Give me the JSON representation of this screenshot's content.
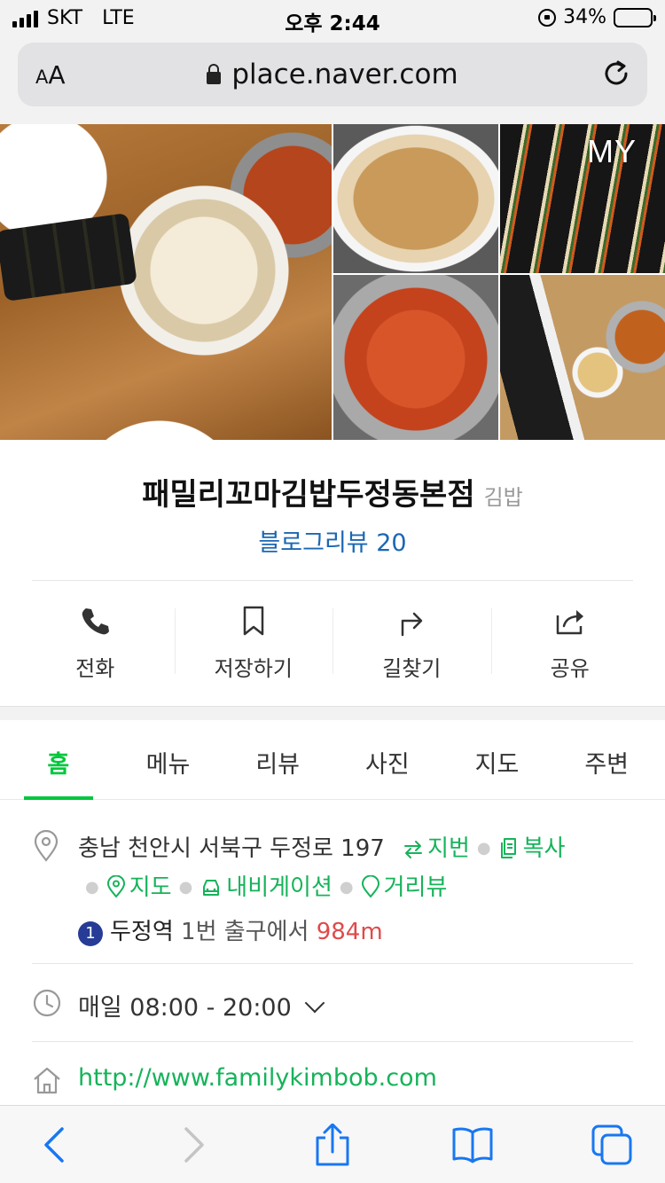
{
  "status_bar": {
    "carrier": "SKT",
    "network": "LTE",
    "time": "오후 2:44",
    "battery_percent": "34%",
    "battery_level": 0.34
  },
  "browser": {
    "text_size_label_small": "A",
    "text_size_label_large": "A",
    "url": "place.naver.com",
    "icons": [
      "lock-icon",
      "reload-icon"
    ]
  },
  "gallery": {
    "my_label": "MY",
    "photo_count_shown": 5
  },
  "place": {
    "name": "패밀리꼬마김밥두정동본점",
    "category": "김밥",
    "blog_review_label": "블로그리뷰 20"
  },
  "actions": [
    {
      "label": "전화",
      "icon": "phone-icon"
    },
    {
      "label": "저장하기",
      "icon": "bookmark-icon"
    },
    {
      "label": "길찾기",
      "icon": "directions-icon"
    },
    {
      "label": "공유",
      "icon": "share-icon"
    }
  ],
  "tabs": [
    {
      "label": "홈",
      "active": true
    },
    {
      "label": "메뉴",
      "active": false
    },
    {
      "label": "리뷰",
      "active": false
    },
    {
      "label": "사진",
      "active": false
    },
    {
      "label": "지도",
      "active": false
    },
    {
      "label": "주변",
      "active": false
    }
  ],
  "address": {
    "text": "충남 천안시 서북구 두정로 197",
    "jibun_label": "지번",
    "copy_label": "복사",
    "map_label": "지도",
    "navigation_label": "내비게이션",
    "streetview_label": "거리뷰",
    "subway_line": "1",
    "station": "두정역",
    "exit_text": "1번 출구에서",
    "distance": "984m"
  },
  "hours": {
    "text": "매일 08:00 - 20:00"
  },
  "website": {
    "url": "http://www.familykimbob.com"
  },
  "colors": {
    "accent_green": "#00c73c",
    "link_blue": "#1b67b3",
    "distance_red": "#e04a4a",
    "subway_line1": "#263c96",
    "ios_blue": "#1877f2"
  }
}
